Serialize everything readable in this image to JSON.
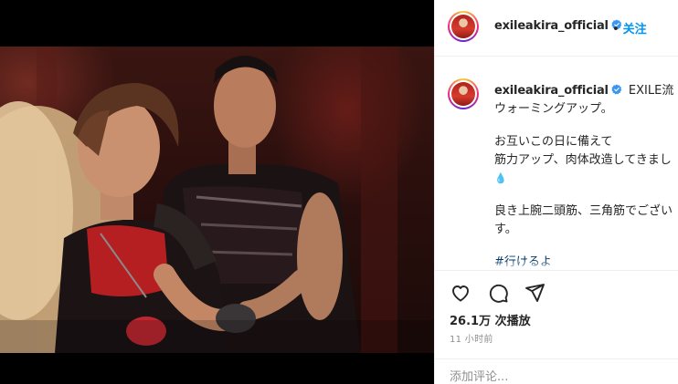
{
  "post": {
    "username": "exileakira_official",
    "follow_separator": "•",
    "follow_label": "关注"
  },
  "caption": {
    "username": "exileakira_official",
    "lines": [
      "EXILE流",
      "ウォーミングアップ。",
      "お互いこの日に備えて",
      "筋力アップ、肉体改造してきまし",
      "良き上腕二頭筋、三角筋でござい",
      "す。",
      "#行けるよ"
    ],
    "emoji": "💧"
  },
  "stats": {
    "views": "26.1万 次播放",
    "time": "11 小时前"
  },
  "comment": {
    "placeholder": "添加评论..."
  },
  "icons": {
    "like": "heart-icon",
    "comment": "comment-icon",
    "share": "share-icon",
    "mute": "speaker-muted-icon",
    "verified": "verified-badge-icon"
  },
  "colors": {
    "accent": "#0095f6",
    "hashtag": "#00376b",
    "text": "#262626",
    "muted": "#8e8e8e",
    "verified": "#3897f0"
  }
}
